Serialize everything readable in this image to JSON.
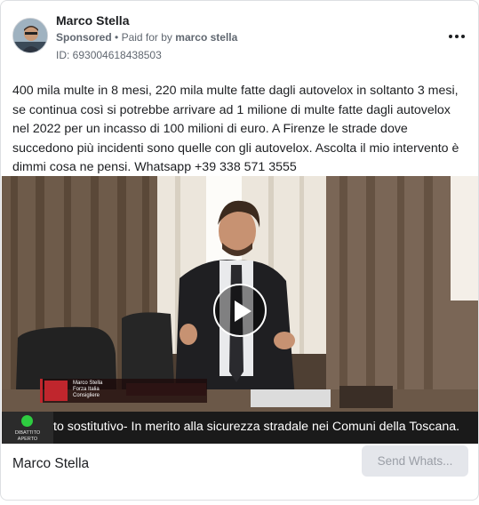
{
  "post": {
    "author": "Marco Stella",
    "sponsored_label": "Sponsored",
    "paid_for_prefix": "Paid for by",
    "paid_for_by": "marco stella",
    "ad_id": "ID: 693004618438503",
    "body": "400 mila multe in 8 mesi, 220 mila multe fatte dagli autovelox in soltanto 3 mesi, se continua così si potrebbe arrivare ad 1 milione di multe fatte dagli autovelox nel 2022 per un incasso di 100 milioni di euro. A Firenze le strade dove succedono più incidenti sono quelle con gli autovelox. Ascolta il mio intervento è dimmi cosa ne pensi. Whatsapp +39 338 571 3555",
    "more_icon": "more-horizontal-icon"
  },
  "video": {
    "lower_third": {
      "line1": "Marco Stella",
      "line2": "Forza Italia",
      "line3": "Consigliere"
    },
    "ticker": {
      "badge_line1": "DIBATTITO",
      "badge_line2": "APERTO",
      "text": "to sostitutivo- In merito alla sicurezza stradale nei Comuni della Toscana."
    },
    "play_icon": "play-icon"
  },
  "footer": {
    "page_name": "Marco Stella",
    "cta_label": "Send Whats..."
  },
  "colors": {
    "live_indicator": "#2ecc40",
    "brand_red": "#c0262d",
    "cta_bg": "#e4e6eb"
  }
}
